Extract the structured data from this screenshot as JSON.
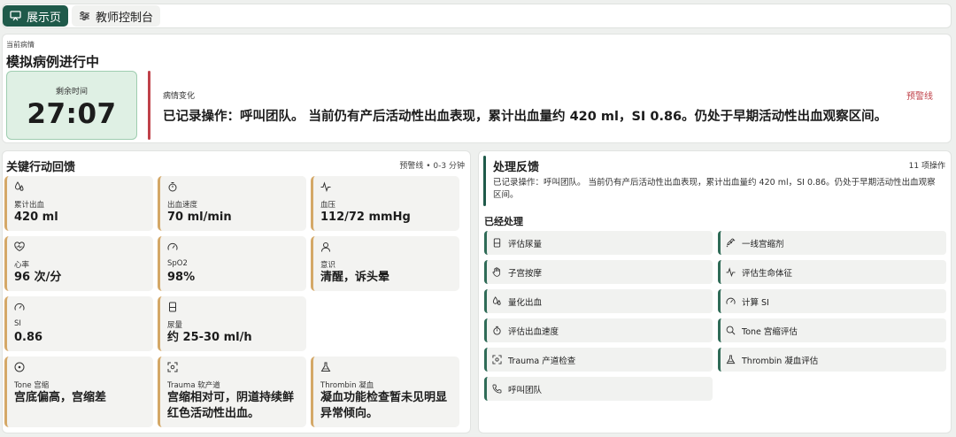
{
  "tabs": [
    {
      "label": "展示页",
      "icon": "presentation-icon",
      "active": true
    },
    {
      "label": "教师控制台",
      "icon": "sliders-icon",
      "active": false
    }
  ],
  "status": {
    "subtitle": "当前病情",
    "title": "模拟病例进行中",
    "timer_label": "剩余时间",
    "timer_value": "27:07",
    "change_label": "病情变化",
    "change_text": "已记录操作：呼叫团队。 当前仍有产后活动性出血表现，累计出血量约 420 ml，SI 0.86。仍处于早期活动性出血观察区间。",
    "alert": "预警线"
  },
  "actions_panel": {
    "title": "关键行动回馈",
    "meta": "预警线 • 0-3 分钟",
    "cards": [
      {
        "icon": "drops-icon",
        "label": "累计出血",
        "value": "420 ml"
      },
      {
        "icon": "stopwatch-icon",
        "label": "出血速度",
        "value": "70 ml/min"
      },
      {
        "icon": "pulse-icon",
        "label": "血压",
        "value": "112/72 mmHg"
      },
      {
        "icon": "heart-pulse-icon",
        "label": "心率",
        "value": "96 次/分"
      },
      {
        "icon": "gauge-icon",
        "label": "SpO2",
        "value": "98%"
      },
      {
        "icon": "user-icon",
        "label": "意识",
        "value": "清醒，诉头晕"
      },
      {
        "icon": "gauge-icon",
        "label": "SI",
        "value": "0.86"
      },
      {
        "icon": "urine-bag-icon",
        "label": "尿量",
        "value": "约 25-30 ml/h"
      },
      {
        "icon": "target-icon",
        "label": "Tone 宫缩",
        "value": "宫底偏高，宫缩差"
      },
      {
        "icon": "scan-icon",
        "label": "Trauma 软产道",
        "value": "宫缩相对可，阴道持续鲜红色活动性出血。"
      },
      {
        "icon": "flask-icon",
        "label": "Thrombin 凝血",
        "value": "凝血功能检查暂未见明显异常倾向。"
      }
    ]
  },
  "feedback_panel": {
    "title": "处理反馈",
    "count": "11 项操作",
    "text": "已记录操作：呼叫团队。 当前仍有产后活动性出血表现，累计出血量约 420 ml，SI 0.86。仍处于早期活动性出血观察区间。",
    "done_title": "已经处理",
    "items": [
      {
        "icon": "urine-bag-icon",
        "label": "评估尿量"
      },
      {
        "icon": "syringe-icon",
        "label": "一线宫缩剂"
      },
      {
        "icon": "hand-icon",
        "label": "子宫按摩"
      },
      {
        "icon": "pulse-icon",
        "label": "评估生命体征"
      },
      {
        "icon": "drops-icon",
        "label": "量化出血"
      },
      {
        "icon": "gauge-icon",
        "label": "计算 SI"
      },
      {
        "icon": "stopwatch-icon",
        "label": "评估出血速度"
      },
      {
        "icon": "search-icon",
        "label": "Tone 宫缩评估"
      },
      {
        "icon": "scan-icon",
        "label": "Trauma 产道检查"
      },
      {
        "icon": "flask-icon",
        "label": "Thrombin 凝血评估"
      },
      {
        "icon": "phone-icon",
        "label": "呼叫团队"
      }
    ]
  },
  "colors": {
    "brand": "#1f5a4a",
    "alert": "#c0424a",
    "card_accent": "#d4a867",
    "timer_bg": "#dff0e4"
  }
}
